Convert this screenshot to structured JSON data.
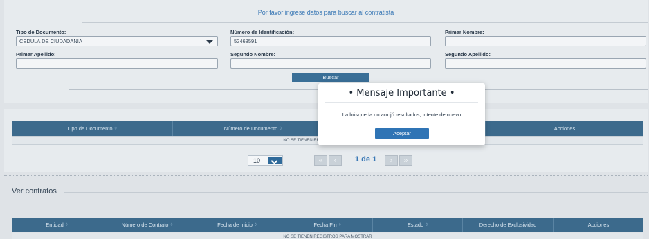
{
  "search": {
    "instruction": "Por favor ingrese datos para buscar al contratista",
    "fields": {
      "tipo_documento": {
        "label": "Tipo de Documento:",
        "value": "CEDULA DE CIUDADANIA"
      },
      "numero_identificacion": {
        "label": "Número de Identificación:",
        "value": "52468591"
      },
      "primer_nombre": {
        "label": "Primer Nombre:",
        "value": ""
      },
      "primer_apellido": {
        "label": "Primer Apellido:",
        "value": ""
      },
      "segundo_nombre": {
        "label": "Segundo Nombre:",
        "value": ""
      },
      "segundo_apellido": {
        "label": "Segundo Apellido:",
        "value": ""
      }
    },
    "button_label": "Buscar"
  },
  "results": {
    "columns": [
      "Tipo de Documento",
      "Número de Documento",
      "Acciones"
    ],
    "empty_message": "NO SE TIENEN REGISTROS PARA MOSTRAR",
    "page_size": "10",
    "page_label": "1 de 1",
    "pager_icons": [
      "first-page-icon",
      "prev-page-icon",
      "next-page-icon",
      "last-page-icon"
    ]
  },
  "contracts": {
    "title": "Ver contratos",
    "columns": [
      "Entidad",
      "Número de Contrato",
      "Fecha de Inicio",
      "Fecha Fin",
      "Estado",
      "Derecho de Exclusividad",
      "Acciones"
    ],
    "sortable": [
      true,
      true,
      true,
      true,
      true,
      false,
      false
    ],
    "empty_message": "NO SE TIENEN REGISTROS PARA MOSTRAR"
  },
  "modal": {
    "title": "• Mensaje Importante •",
    "message": "La búsqueda no arrojó resultados, intente de nuevo",
    "button_label": "Aceptar"
  },
  "colors": {
    "accent": "#3a78b5",
    "table_header": "#3c6a8c",
    "primary_button": "#2f74b5"
  }
}
